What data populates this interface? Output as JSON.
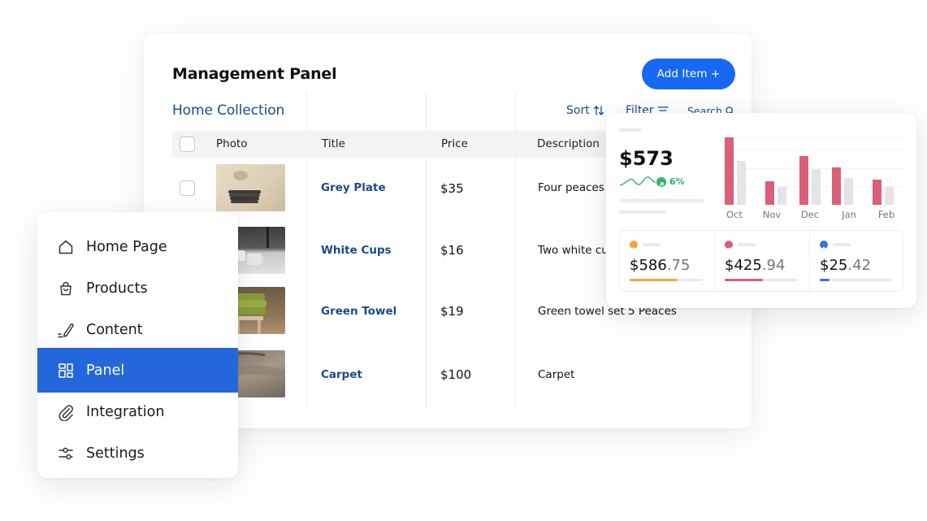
{
  "panel": {
    "title": "Management Panel",
    "add_button": "Add Item +",
    "collection_title": "Home Collection",
    "tools": {
      "sort": "Sort",
      "filter": "Filter",
      "search": "Search"
    },
    "columns": [
      "Photo",
      "Title",
      "Price",
      "Description"
    ],
    "rows": [
      {
        "title": "Grey Plate",
        "price": "$35",
        "description": "Four peaces"
      },
      {
        "title": "White Cups",
        "price": "$16",
        "description": "Two white cu"
      },
      {
        "title": "Green Towel",
        "price": "$19",
        "description": "Green towel set 5 Peaces"
      },
      {
        "title": "Carpet",
        "price": "$100",
        "description": "Carpet"
      }
    ]
  },
  "sidebar": {
    "items": [
      {
        "label": "Home Page",
        "icon": "home-icon"
      },
      {
        "label": "Products",
        "icon": "bag-icon"
      },
      {
        "label": "Content",
        "icon": "pen-icon"
      },
      {
        "label": "Panel",
        "icon": "dashboard-icon",
        "active": true
      },
      {
        "label": "Integration",
        "icon": "paperclip-icon"
      },
      {
        "label": "Settings",
        "icon": "sliders-icon"
      }
    ]
  },
  "analytics": {
    "total": "$573",
    "change": "6%",
    "months": [
      "Oct",
      "Nov",
      "Dec",
      "Jan",
      "Feb"
    ],
    "colors": {
      "accent": "#dc5f78",
      "muted": "#e3e3e8",
      "green": "#2fb36a"
    },
    "bars": {
      "primary": [
        1.0,
        0.35,
        0.72,
        0.55,
        0.37
      ],
      "secondary": [
        0.65,
        0.27,
        0.53,
        0.4,
        0.27
      ]
    },
    "stats": [
      {
        "whole": "$586",
        "frac": ".75",
        "color": "#f5a53b",
        "progress": 0.65
      },
      {
        "whole": "$425",
        "frac": ".94",
        "color": "#dc5f78",
        "progress": 0.52
      },
      {
        "whole": "$25",
        "frac": ".42",
        "color": "#3a6fe0",
        "progress": 0.13
      }
    ]
  }
}
